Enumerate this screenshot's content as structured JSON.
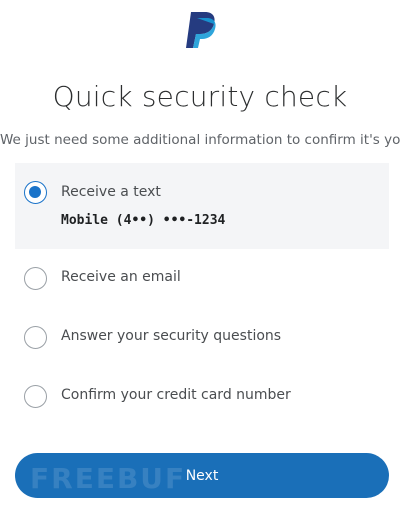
{
  "brand": {
    "logo_icon": "paypal-logo-icon",
    "primary_color": "#1a6fb8",
    "logo_dark": "#253b80",
    "logo_light": "#179bd7"
  },
  "header": {
    "title": "Quick security check",
    "subtitle": "We just need some additional information to confirm it's you."
  },
  "options": [
    {
      "label": "Receive a text",
      "detail": "Mobile (4••) •••-1234",
      "selected": true
    },
    {
      "label": "Receive an email",
      "selected": false
    },
    {
      "label": "Answer your security questions",
      "selected": false
    },
    {
      "label": "Confirm your credit card number",
      "selected": false
    }
  ],
  "actions": {
    "next_label": "Next"
  },
  "watermark": {
    "text": "FREEBUF"
  }
}
